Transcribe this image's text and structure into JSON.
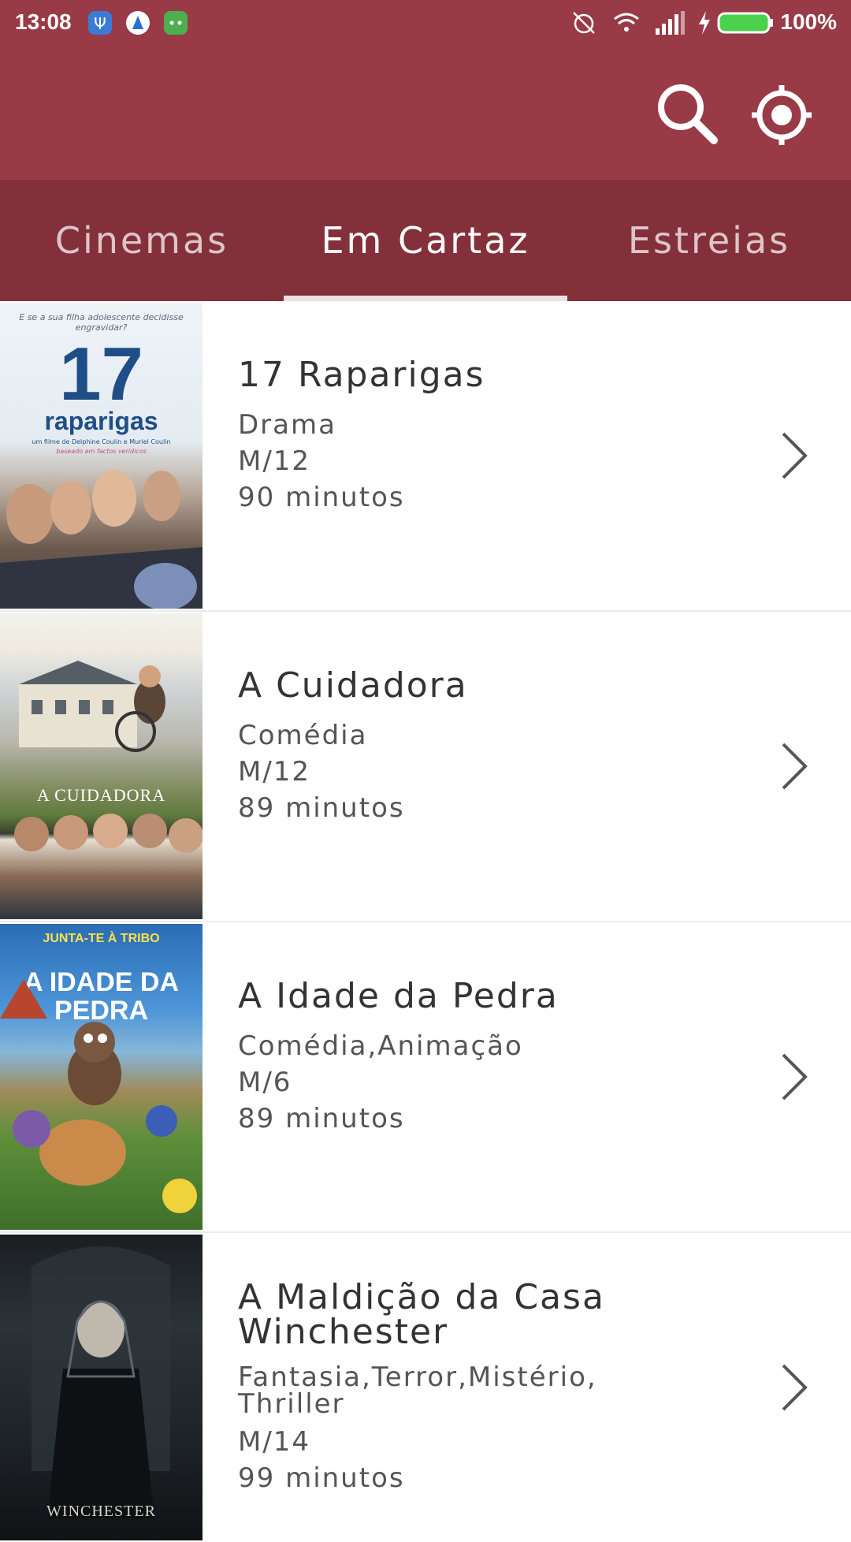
{
  "status_bar": {
    "time": "13:08",
    "battery_percent": "100%",
    "icons": [
      "usb-icon",
      "notification-a-icon",
      "android-icon",
      "alarm-off-icon",
      "wifi-icon",
      "signal-icon",
      "charging-icon",
      "battery-icon"
    ]
  },
  "app_bar": {
    "actions": [
      "search-icon",
      "locate-icon"
    ]
  },
  "tabs": [
    {
      "label": "Cinemas"
    },
    {
      "label": "Em Cartaz"
    },
    {
      "label": "Estreias"
    }
  ],
  "movies": [
    {
      "title": "17 Raparigas",
      "genre": "Drama",
      "rating": "M/12",
      "duration": "90 minutos",
      "poster": {
        "tagline": "E se a sua filha adolescente decidisse engravidar?",
        "big": "17",
        "name": "raparigas",
        "sub": "um filme de Delphine Coulin e Muriel Coulin",
        "sub2": "baseado em factos verídicos"
      }
    },
    {
      "title": "A Cuidadora",
      "genre": "Comédia",
      "rating": "M/12",
      "duration": "89 minutos",
      "poster": {
        "name": "A CUIDADORA"
      }
    },
    {
      "title": "A Idade da Pedra",
      "genre": "Comédia,Animação",
      "rating": "M/6",
      "duration": "89 minutos",
      "poster": {
        "tagline": "JUNTA-TE À TRIBO",
        "name": "A IDADE DA PEDRA"
      }
    },
    {
      "title": "A Maldição da Casa Winchester",
      "genre": "Fantasia,Terror,Mistério,Thriller",
      "rating": "M/14",
      "duration": "99 minutos",
      "poster": {
        "name": "WINCHESTER"
      }
    }
  ],
  "colors": {
    "primary": "#993a47",
    "tab_bar": "#84303b"
  }
}
